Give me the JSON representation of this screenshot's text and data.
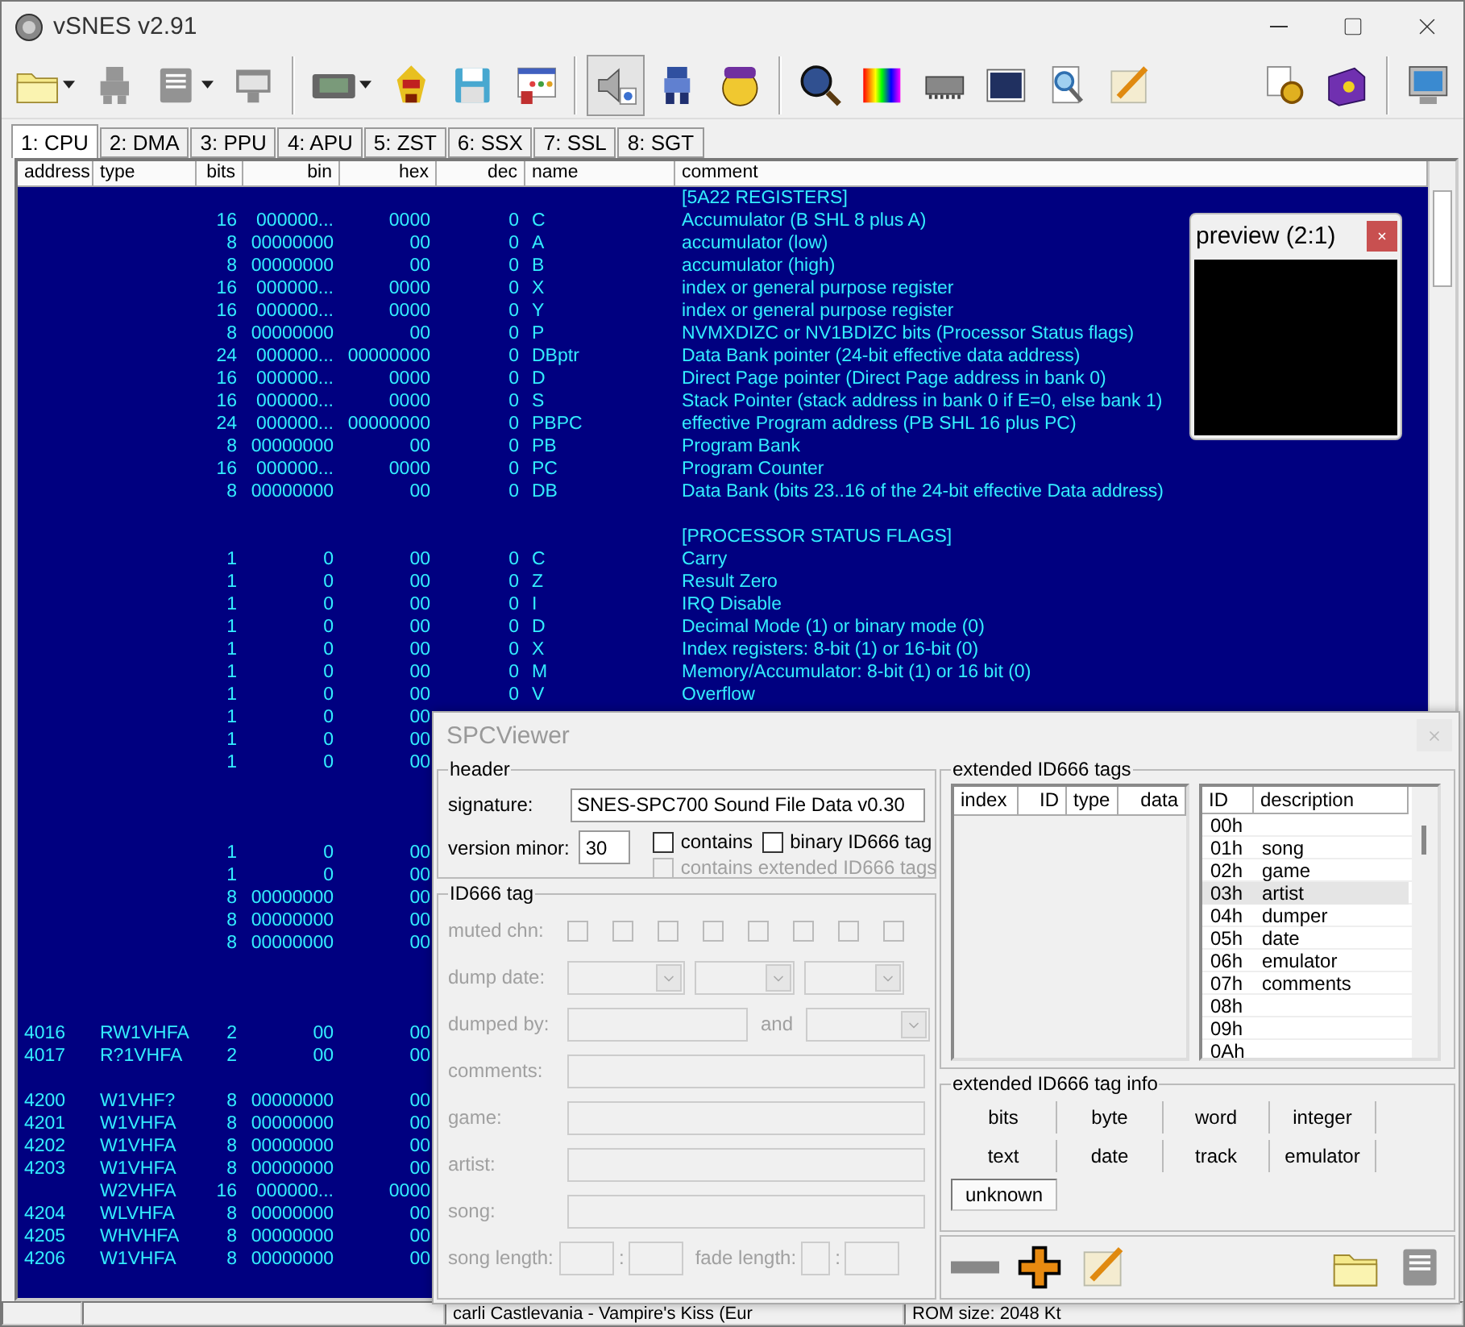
{
  "window": {
    "title": "vSNES v2.91"
  },
  "toolbar": [
    {
      "kind": "folder",
      "disabled": false,
      "pressed": false,
      "dropdown": true,
      "gap_before": false
    },
    {
      "kind": "figure",
      "disabled": true,
      "pressed": false,
      "dropdown": false,
      "gap_before": false
    },
    {
      "kind": "document",
      "disabled": true,
      "pressed": false,
      "dropdown": true,
      "gap_before": false
    },
    {
      "kind": "window",
      "disabled": true,
      "pressed": false,
      "dropdown": false,
      "gap_before": false
    },
    {
      "kind": "separator"
    },
    {
      "kind": "cartridge",
      "disabled": false,
      "pressed": false,
      "dropdown": true,
      "gap_before": false
    },
    {
      "kind": "sprite",
      "disabled": false,
      "pressed": false,
      "dropdown": false,
      "gap_before": false
    },
    {
      "kind": "floppy",
      "disabled": false,
      "pressed": false,
      "dropdown": false,
      "gap_before": false
    },
    {
      "kind": "dialog",
      "disabled": false,
      "pressed": false,
      "dropdown": false,
      "gap_before": false
    },
    {
      "kind": "separator"
    },
    {
      "kind": "speaker",
      "disabled": false,
      "pressed": true,
      "dropdown": false,
      "gap_before": false
    },
    {
      "kind": "sprite2",
      "disabled": false,
      "pressed": false,
      "dropdown": false,
      "gap_before": false
    },
    {
      "kind": "face",
      "disabled": false,
      "pressed": false,
      "dropdown": false,
      "gap_before": false
    },
    {
      "kind": "separator"
    },
    {
      "kind": "magnifier",
      "disabled": false,
      "pressed": false,
      "dropdown": false,
      "gap_before": false
    },
    {
      "kind": "palette",
      "disabled": false,
      "pressed": false,
      "dropdown": false,
      "gap_before": false
    },
    {
      "kind": "chip",
      "disabled": false,
      "pressed": false,
      "dropdown": false,
      "gap_before": false
    },
    {
      "kind": "monitor",
      "disabled": false,
      "pressed": false,
      "dropdown": false,
      "gap_before": false
    },
    {
      "kind": "docsearch",
      "disabled": false,
      "pressed": false,
      "dropdown": false,
      "gap_before": false
    },
    {
      "kind": "pencil",
      "disabled": false,
      "pressed": false,
      "dropdown": false,
      "gap_before": false
    },
    {
      "kind": "gear",
      "disabled": false,
      "pressed": false,
      "dropdown": false,
      "gap_before": true
    },
    {
      "kind": "book",
      "disabled": false,
      "pressed": false,
      "dropdown": false,
      "gap_before": false
    },
    {
      "kind": "separator"
    },
    {
      "kind": "computer",
      "disabled": false,
      "pressed": false,
      "dropdown": false,
      "gap_before": false
    }
  ],
  "tabs": [
    {
      "label": "1: CPU",
      "selected": true
    },
    {
      "label": "2: DMA",
      "selected": false
    },
    {
      "label": "3: PPU",
      "selected": false
    },
    {
      "label": "4: APU",
      "selected": false
    },
    {
      "label": "5: ZST",
      "selected": false
    },
    {
      "label": "6: SSX",
      "selected": false
    },
    {
      "label": "7: SSL",
      "selected": false
    },
    {
      "label": "8: SGT",
      "selected": false
    }
  ],
  "table": {
    "columns": [
      "address",
      "type",
      "bits",
      "bin",
      "hex",
      "dec",
      "name",
      "comment"
    ],
    "rows": [
      {
        "comment": "[5A22 REGISTERS]"
      },
      {
        "bits": "16",
        "bin": "000000...",
        "hex": "0000",
        "dec": "0",
        "name": "C",
        "comment": "Accumulator (B SHL 8 plus A)"
      },
      {
        "bits": "8",
        "bin": "00000000",
        "hex": "00",
        "dec": "0",
        "name": "A",
        "comment": "accumulator (low)"
      },
      {
        "bits": "8",
        "bin": "00000000",
        "hex": "00",
        "dec": "0",
        "name": "B",
        "comment": "accumulator (high)"
      },
      {
        "bits": "16",
        "bin": "000000...",
        "hex": "0000",
        "dec": "0",
        "name": "X",
        "comment": "index or general purpose register"
      },
      {
        "bits": "16",
        "bin": "000000...",
        "hex": "0000",
        "dec": "0",
        "name": "Y",
        "comment": "index or general purpose register"
      },
      {
        "bits": "8",
        "bin": "00000000",
        "hex": "00",
        "dec": "0",
        "name": "P",
        "comment": "NVMXDIZC or NV1BDIZC bits (Processor Status flags)"
      },
      {
        "bits": "24",
        "bin": "000000...",
        "hex": "00000000",
        "dec": "0",
        "name": "DBptr",
        "comment": "Data Bank pointer (24-bit effective data address)"
      },
      {
        "bits": "16",
        "bin": "000000...",
        "hex": "0000",
        "dec": "0",
        "name": "D",
        "comment": "Direct Page pointer (Direct Page address in bank 0)"
      },
      {
        "bits": "16",
        "bin": "000000...",
        "hex": "0000",
        "dec": "0",
        "name": "S",
        "comment": "Stack Pointer (stack address in bank 0 if E=0, else bank 1)"
      },
      {
        "bits": "24",
        "bin": "000000...",
        "hex": "00000000",
        "dec": "0",
        "name": "PBPC",
        "comment": "effective Program address (PB SHL 16 plus PC)"
      },
      {
        "bits": "8",
        "bin": "00000000",
        "hex": "00",
        "dec": "0",
        "name": "PB",
        "comment": "Program Bank"
      },
      {
        "bits": "16",
        "bin": "000000...",
        "hex": "0000",
        "dec": "0",
        "name": "PC",
        "comment": "Program Counter"
      },
      {
        "bits": "8",
        "bin": "00000000",
        "hex": "00",
        "dec": "0",
        "name": "DB",
        "comment": "Data Bank (bits 23..16 of the 24-bit effective Data address)"
      },
      {},
      {
        "comment": "[PROCESSOR STATUS FLAGS]"
      },
      {
        "bits": "1",
        "bin": "0",
        "hex": "00",
        "dec": "0",
        "name": "C",
        "comment": "Carry"
      },
      {
        "bits": "1",
        "bin": "0",
        "hex": "00",
        "dec": "0",
        "name": "Z",
        "comment": "Result Zero"
      },
      {
        "bits": "1",
        "bin": "0",
        "hex": "00",
        "dec": "0",
        "name": "I",
        "comment": "IRQ Disable"
      },
      {
        "bits": "1",
        "bin": "0",
        "hex": "00",
        "dec": "0",
        "name": "D",
        "comment": "Decimal Mode (1) or binary mode (0)"
      },
      {
        "bits": "1",
        "bin": "0",
        "hex": "00",
        "dec": "0",
        "name": "X",
        "comment": "Index registers: 8-bit (1) or 16-bit (0)"
      },
      {
        "bits": "1",
        "bin": "0",
        "hex": "00",
        "dec": "0",
        "name": "M",
        "comment": "Memory/Accumulator: 8-bit (1) or 16 bit (0)"
      },
      {
        "bits": "1",
        "bin": "0",
        "hex": "00",
        "dec": "0",
        "name": "V",
        "comment": "Overflow"
      },
      {
        "bits": "1",
        "bin": "0",
        "hex": "00"
      },
      {
        "bits": "1",
        "bin": "0",
        "hex": "00"
      },
      {
        "bits": "1",
        "bin": "0",
        "hex": "00"
      },
      {},
      {},
      {},
      {
        "bits": "1",
        "bin": "0",
        "hex": "00"
      },
      {
        "bits": "1",
        "bin": "0",
        "hex": "00"
      },
      {
        "bits": "8",
        "bin": "00000000",
        "hex": "00"
      },
      {
        "bits": "8",
        "bin": "00000000",
        "hex": "00"
      },
      {
        "bits": "8",
        "bin": "00000000",
        "hex": "00"
      },
      {},
      {},
      {},
      {
        "address": "4016",
        "type": "RW1VHFA",
        "bits": "2",
        "bin": "00",
        "hex": "00"
      },
      {
        "address": "4017",
        "type": "R?1VHFA",
        "bits": "2",
        "bin": "00",
        "hex": "00"
      },
      {},
      {
        "address": "4200",
        "type": "W1VHF?",
        "bits": "8",
        "bin": "00000000",
        "hex": "00"
      },
      {
        "address": "4201",
        "type": "W1VHFA",
        "bits": "8",
        "bin": "00000000",
        "hex": "00"
      },
      {
        "address": "4202",
        "type": "W1VHFA",
        "bits": "8",
        "bin": "00000000",
        "hex": "00"
      },
      {
        "address": "4203",
        "type": "W1VHFA",
        "bits": "8",
        "bin": "00000000",
        "hex": "00"
      },
      {
        "type": "W2VHFA",
        "bits": "16",
        "bin": "000000...",
        "hex": "0000"
      },
      {
        "address": "4204",
        "type": "WLVHFA",
        "bits": "8",
        "bin": "00000000",
        "hex": "00"
      },
      {
        "address": "4205",
        "type": "WHVHFA",
        "bits": "8",
        "bin": "00000000",
        "hex": "00"
      },
      {
        "address": "4206",
        "type": "W1VHFA",
        "bits": "8",
        "bin": "00000000",
        "hex": "00"
      }
    ]
  },
  "status_bar": [
    "carli Castlevania - Vampire's Kiss (Eur",
    "ROM size: 2048 Kt"
  ],
  "preview": {
    "title": "preview (2:1)"
  },
  "spc_viewer": {
    "title": "SPCViewer",
    "header": {
      "legend": "header",
      "signature_label": "signature:",
      "signature": "SNES-SPC700 Sound File Data v0.30",
      "version_label": "version minor:",
      "version": "30",
      "checkboxes": [
        {
          "label": "contains",
          "checked": false,
          "disabled": false
        },
        {
          "label": "binary ID666 tag",
          "checked": false,
          "disabled": false
        },
        {
          "label": "contains extended ID666 tags",
          "checked": false,
          "disabled": true
        }
      ]
    },
    "id666": {
      "legend": "ID666 tag",
      "disabled": true,
      "muted_label": "muted chn:",
      "channels": [
        {
          "checked": false
        },
        {
          "checked": false
        },
        {
          "checked": false
        },
        {
          "checked": false
        },
        {
          "checked": false
        },
        {
          "checked": false
        },
        {
          "checked": false
        },
        {
          "checked": false
        }
      ],
      "fields": [
        {
          "kind": "date",
          "label": "dump date:"
        },
        {
          "kind": "dumper",
          "label": "dumped by:",
          "and_label": "and"
        },
        {
          "kind": "text",
          "label": "comments:"
        },
        {
          "kind": "text",
          "label": "game:"
        },
        {
          "kind": "text",
          "label": "artist:"
        },
        {
          "kind": "text",
          "label": "song:"
        },
        {
          "kind": "length",
          "label": "song length:",
          "separator": ":",
          "fade_label": "fade length:"
        }
      ]
    },
    "extended": {
      "legend": "extended ID666 tags",
      "tag_columns": [
        "index",
        "ID",
        "type",
        "data"
      ],
      "id_columns": [
        "ID",
        "description"
      ],
      "ids": [
        {
          "id": "00h",
          "selected": false
        },
        {
          "id": "01h",
          "description": "song",
          "selected": false
        },
        {
          "id": "02h",
          "description": "game",
          "selected": false
        },
        {
          "id": "03h",
          "description": "artist",
          "selected": true
        },
        {
          "id": "04h",
          "description": "dumper",
          "selected": false
        },
        {
          "id": "05h",
          "description": "date",
          "selected": false
        },
        {
          "id": "06h",
          "description": "emulator",
          "selected": false
        },
        {
          "id": "07h",
          "description": "comments",
          "selected": false
        },
        {
          "id": "08h",
          "selected": false
        },
        {
          "id": "09h",
          "selected": false
        },
        {
          "id": "0Ah",
          "selected": false
        }
      ]
    },
    "info": {
      "legend": "extended ID666 tag info",
      "types": [
        {
          "label": "bits",
          "selected": false
        },
        {
          "label": "byte",
          "selected": false
        },
        {
          "label": "word",
          "selected": false
        },
        {
          "label": "integer",
          "selected": false
        },
        {
          "label": "text",
          "selected": false
        },
        {
          "label": "date",
          "selected": false
        },
        {
          "label": "track",
          "selected": false
        },
        {
          "label": "emulator",
          "selected": false
        },
        {
          "label": "unknown",
          "selected": true
        }
      ]
    },
    "tools_left": [
      {
        "kind": "remove",
        "disabled": true
      },
      {
        "kind": "add",
        "disabled": false
      },
      {
        "kind": "edit",
        "disabled": false
      }
    ],
    "tools_right": [
      {
        "kind": "open",
        "disabled": false
      },
      {
        "kind": "save",
        "disabled": true
      }
    ]
  }
}
